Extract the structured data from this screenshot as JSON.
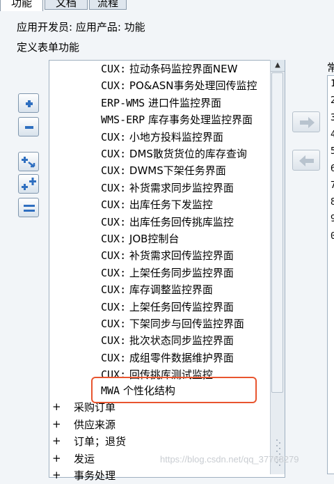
{
  "tabs": [
    {
      "label": "功能",
      "active": true
    },
    {
      "label": "文档",
      "active": false
    },
    {
      "label": "流程",
      "active": false
    }
  ],
  "breadcrumb": "应用开发员: 应用产品: 功能",
  "section_title": "定义表单功能",
  "list": {
    "items": [
      {
        "prefix": "CUX:",
        "text": "拉动条码监控界面NEW"
      },
      {
        "prefix": "CUX:",
        "text": "PO&ASN事务处理回传监控"
      },
      {
        "prefix": "ERP-WMS",
        "text": "进口件监控界面"
      },
      {
        "prefix": "WMS-ERP",
        "text": "库存事务处理监控界面"
      },
      {
        "prefix": "CUX:",
        "text": "小地方投料监控界面"
      },
      {
        "prefix": "CUX:",
        "text": "DMS散货货位的库存查询"
      },
      {
        "prefix": "CUX:",
        "text": "DWMS下架任务界面"
      },
      {
        "prefix": "CUX:",
        "text": "补货需求同步监控界面"
      },
      {
        "prefix": "CUX:",
        "text": "出库任务下发监控"
      },
      {
        "prefix": "CUX:",
        "text": "出库任务回传挑库监控"
      },
      {
        "prefix": "CUX:",
        "text": "JOB控制台"
      },
      {
        "prefix": "CUX:",
        "text": "补货需求回传监控界面"
      },
      {
        "prefix": "CUX:",
        "text": "上架任务同步监控界面"
      },
      {
        "prefix": "CUX:",
        "text": "库存调整监控界面"
      },
      {
        "prefix": "CUX:",
        "text": "上架任务回传监控界面"
      },
      {
        "prefix": "CUX:",
        "text": "下架同步与回传监控界面"
      },
      {
        "prefix": "CUX:",
        "text": "批次状态同步监控界面"
      },
      {
        "prefix": "CUX:",
        "text": "成组零件数据维护界面"
      },
      {
        "prefix": "CUX:",
        "text": "回传挑库测试监控"
      }
    ],
    "selected": {
      "prefix": "MWA",
      "text": "个性化结构"
    },
    "groups": [
      {
        "symbol": "+",
        "label": "采购订单"
      },
      {
        "symbol": "+",
        "label": "供应来源"
      },
      {
        "symbol": "+",
        "label": "订单；退货"
      },
      {
        "symbol": "+",
        "label": "发运"
      },
      {
        "symbol": "+",
        "label": "事务处理"
      }
    ]
  },
  "right_panel": {
    "header": "常",
    "numbers": [
      "1",
      "2",
      "3",
      "4",
      "5",
      "6",
      "7",
      "8",
      "9",
      "0"
    ]
  },
  "watermark": "https://blog.csdn.net/qq_37768279",
  "icons": {
    "add": "plus-icon",
    "remove": "minus-icon",
    "expand": "expand-tree-icon",
    "expand_all": "expand-all-icon",
    "collapse_all": "collapse-all-icon",
    "move_right": "arrow-right-icon",
    "move_left": "arrow-left-icon"
  },
  "colors": {
    "highlight": "#e8552f",
    "button_icon": "#2f6fc0"
  }
}
